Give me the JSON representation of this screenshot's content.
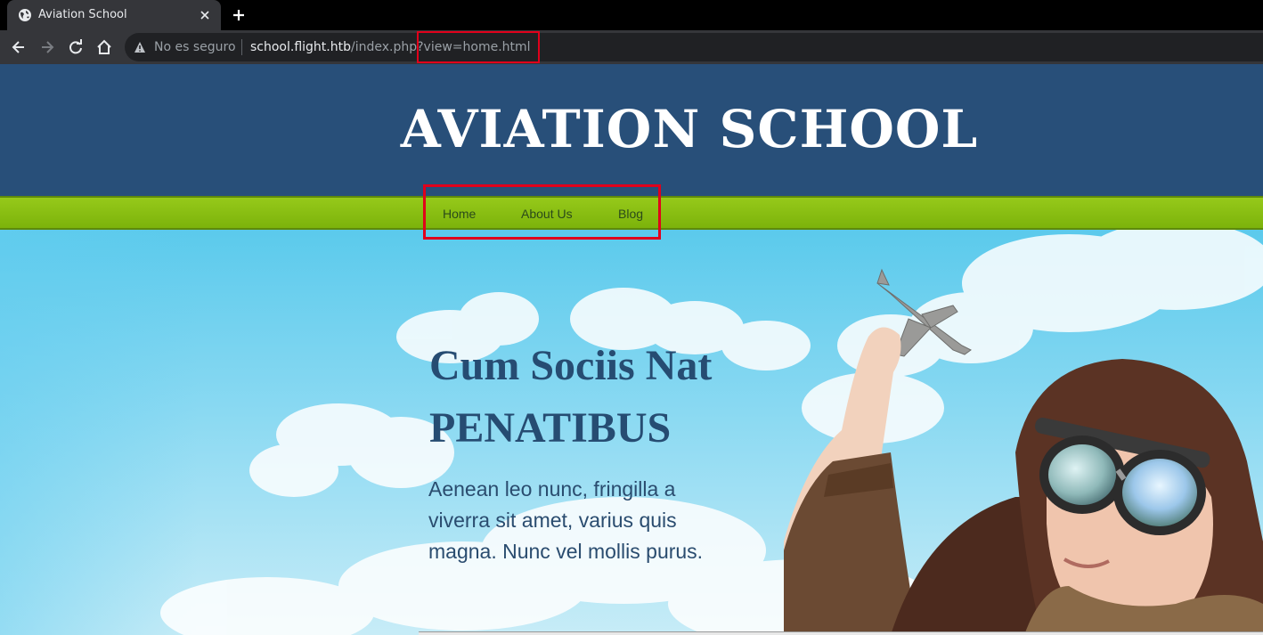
{
  "browser": {
    "tab_title": "Aviation School",
    "security_label": "No es seguro",
    "url_host": "school.flight.htb",
    "url_path": "/index.php?view=home.html",
    "icons": [
      "globe-icon",
      "close-icon",
      "plus-icon",
      "back-icon",
      "forward-icon",
      "reload-icon",
      "home-icon",
      "warning-icon"
    ]
  },
  "site": {
    "title": "AVIATION SCHOOL",
    "nav": [
      "Home",
      "About Us",
      "Blog"
    ],
    "hero_heading_line1": "Cum Sociis Nat",
    "hero_heading_line2": "PENATIBUS",
    "hero_text": "Aenean leo nunc, fringilla a viverra sit amet, varius quis magna. Nunc vel mollis purus."
  },
  "colors": {
    "header": "#284f79",
    "navbar": "#8bc111",
    "highlight": "#e0001b",
    "sky": "#5bcaec"
  }
}
